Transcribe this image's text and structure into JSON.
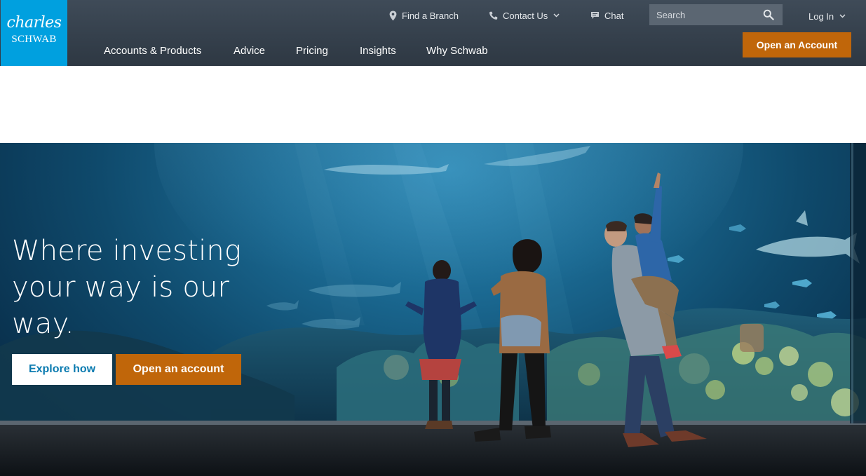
{
  "brand": {
    "line1": "charles",
    "line2": "SCHWAB",
    "color": "#00a0df"
  },
  "utility_nav": {
    "find_branch": "Find a Branch",
    "contact_us": "Contact Us",
    "chat": "Chat",
    "search_placeholder": "Search",
    "login": "Log In"
  },
  "main_nav": {
    "items": [
      "Accounts & Products",
      "Advice",
      "Pricing",
      "Insights",
      "Why Schwab"
    ]
  },
  "header_cta": {
    "label": "Open an Account",
    "color": "#c0660a"
  },
  "hero": {
    "headline": "Where investing your way is our way.",
    "explore_label": "Explore how",
    "open_label": "Open an account"
  },
  "icons": {
    "branch": "map-pin-icon",
    "contact": "phone-icon",
    "chat": "chat-bubble-icon",
    "search": "search-icon",
    "dropdown": "chevron-down-icon"
  },
  "colors": {
    "header_bg": "#38434f",
    "accent_orange": "#c0660a",
    "link_blue": "#0b7bb0"
  }
}
